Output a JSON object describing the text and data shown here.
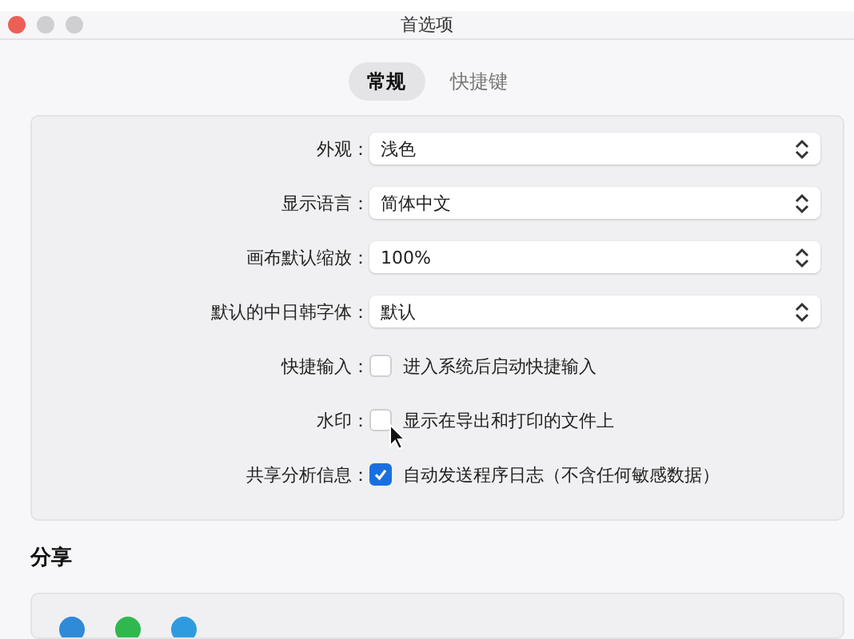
{
  "window": {
    "title": "首选项"
  },
  "tabs": [
    {
      "label": "常规",
      "selected": true
    },
    {
      "label": "快捷键",
      "selected": false
    }
  ],
  "settings": [
    {
      "kind": "select",
      "label": "外观：",
      "value": "浅色"
    },
    {
      "kind": "select",
      "label": "显示语言：",
      "value": "简体中文"
    },
    {
      "kind": "select",
      "label": "画布默认缩放：",
      "value": "100%"
    },
    {
      "kind": "select",
      "label": "默认的中日韩字体：",
      "value": "默认"
    },
    {
      "kind": "checkbox",
      "label": "快捷输入：",
      "text": "进入系统后启动快捷输入",
      "checked": false
    },
    {
      "kind": "checkbox",
      "label": "水印：",
      "text": "显示在导出和打印的文件上",
      "checked": false,
      "pointer": true
    },
    {
      "kind": "checkbox",
      "label": "共享分析信息：",
      "text": "自动发送程序日志（不含任何敏感数据）",
      "checked": true
    }
  ],
  "share": {
    "title": "分享",
    "items": [
      {
        "color": "#2f8ad8"
      },
      {
        "color": "#2fb84e"
      },
      {
        "color": "#2e9be0"
      }
    ]
  }
}
